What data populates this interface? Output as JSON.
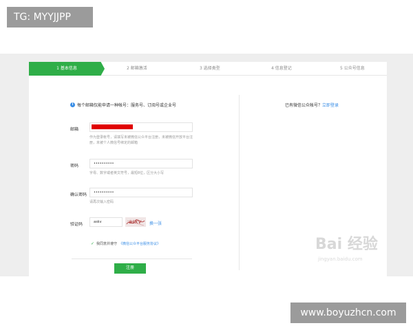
{
  "top_tag": "TG: MYYJJPP",
  "bottom_url": "www.boyuzhcn.com",
  "steps": [
    {
      "label": "1 基本信息",
      "active": true
    },
    {
      "label": "2 邮箱激活",
      "active": false
    },
    {
      "label": "3 选择类型",
      "active": false
    },
    {
      "label": "4 信息登记",
      "active": false
    },
    {
      "label": "5 公众号信息",
      "active": false
    }
  ],
  "notice": "每个邮箱仅能申请一种帐号：服务号、订阅号或企业号",
  "right_note": {
    "text": "已有微信公众帐号？",
    "link": "立即登录"
  },
  "form": {
    "email": {
      "label": "邮箱",
      "hint": "作为登录帐号，请填写未被微信公众平台注册，未被微信开放平台注册，未被个人微信号绑定的邮箱"
    },
    "password": {
      "label": "密码",
      "value": "••••••••••",
      "hint": "字母、数字或者英文符号，最短8位，区分大小写"
    },
    "confirm_password": {
      "label": "确认密码",
      "value": "••••••••••",
      "hint": "请再次输入密码"
    },
    "captcha": {
      "label": "验证码",
      "value": "askv",
      "image_text": "askv",
      "refresh": "换一张"
    },
    "agree": {
      "text": "我同意并遵守",
      "link": "《微信公众平台服务协议》"
    },
    "submit": "注册"
  },
  "watermark": "Bai 经验",
  "watermark_sub": "jingyan.baidu.com",
  "colors": {
    "accent": "#2fae48",
    "link": "#3a8ee6",
    "redaction": "#e00000"
  }
}
